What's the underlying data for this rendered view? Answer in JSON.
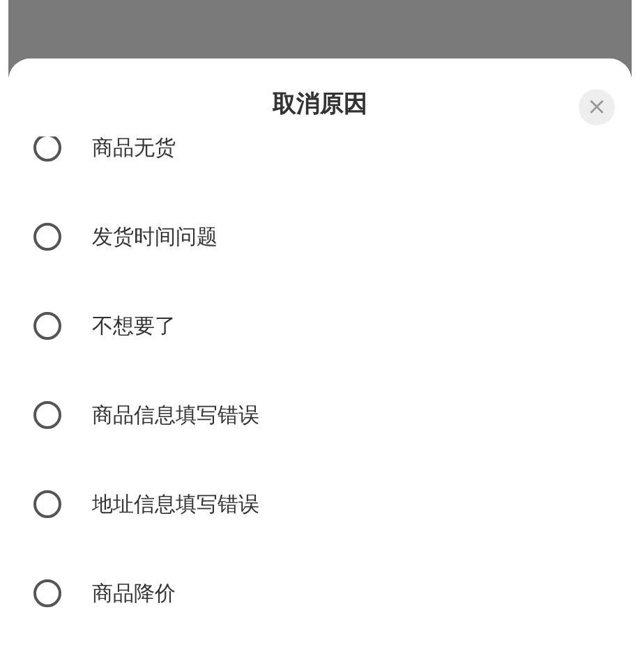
{
  "sheet": {
    "title": "取消原因",
    "close": "×"
  },
  "reasons": [
    {
      "label": "商品无货",
      "selected": false
    },
    {
      "label": "发货时间问题",
      "selected": false
    },
    {
      "label": "不想要了",
      "selected": false
    },
    {
      "label": "商品信息填写错误",
      "selected": false
    },
    {
      "label": "地址信息填写错误",
      "selected": false
    },
    {
      "label": "商品降价",
      "selected": false
    }
  ]
}
